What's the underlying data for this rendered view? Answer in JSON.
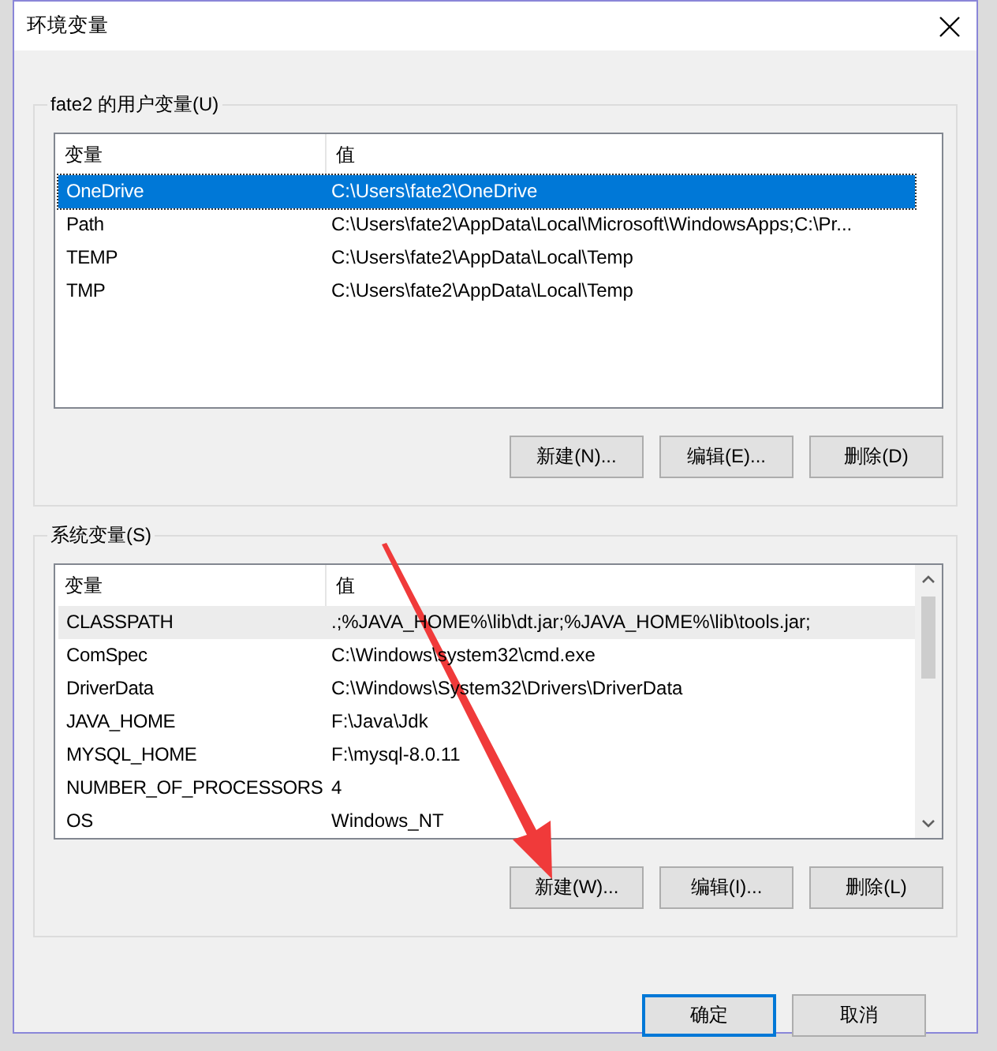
{
  "window": {
    "title": "环境变量"
  },
  "groups": [
    {
      "title": "fate2 的用户变量(U)",
      "focused": true,
      "scrollbar": false,
      "columns": [
        "变量",
        "值"
      ],
      "rows": [
        {
          "name": "OneDrive",
          "value": "C:\\Users\\fate2\\OneDrive",
          "selected": true
        },
        {
          "name": "Path",
          "value": "C:\\Users\\fate2\\AppData\\Local\\Microsoft\\WindowsApps;C:\\Pr...",
          "selected": false
        },
        {
          "name": "TEMP",
          "value": "C:\\Users\\fate2\\AppData\\Local\\Temp",
          "selected": false
        },
        {
          "name": "TMP",
          "value": "C:\\Users\\fate2\\AppData\\Local\\Temp",
          "selected": false
        }
      ],
      "buttons": [
        "新建(N)...",
        "编辑(E)...",
        "删除(D)"
      ]
    },
    {
      "title": "系统变量(S)",
      "focused": false,
      "scrollbar": true,
      "columns": [
        "变量",
        "值"
      ],
      "rows": [
        {
          "name": "CLASSPATH",
          "value": ".;%JAVA_HOME%\\lib\\dt.jar;%JAVA_HOME%\\lib\\tools.jar;",
          "selected": true
        },
        {
          "name": "ComSpec",
          "value": "C:\\Windows\\system32\\cmd.exe",
          "selected": false
        },
        {
          "name": "DriverData",
          "value": "C:\\Windows\\System32\\Drivers\\DriverData",
          "selected": false
        },
        {
          "name": "JAVA_HOME",
          "value": "F:\\Java\\Jdk",
          "selected": false
        },
        {
          "name": "MYSQL_HOME",
          "value": "F:\\mysql-8.0.11",
          "selected": false
        },
        {
          "name": "NUMBER_OF_PROCESSORS",
          "value": "4",
          "selected": false
        },
        {
          "name": "OS",
          "value": "Windows_NT",
          "selected": false
        }
      ],
      "buttons": [
        "新建(W)...",
        "编辑(I)...",
        "删除(L)"
      ]
    }
  ],
  "footer_buttons": [
    {
      "label": "确定",
      "default": true
    },
    {
      "label": "取消",
      "default": false
    }
  ],
  "annotation": {
    "kind": "arrow"
  }
}
